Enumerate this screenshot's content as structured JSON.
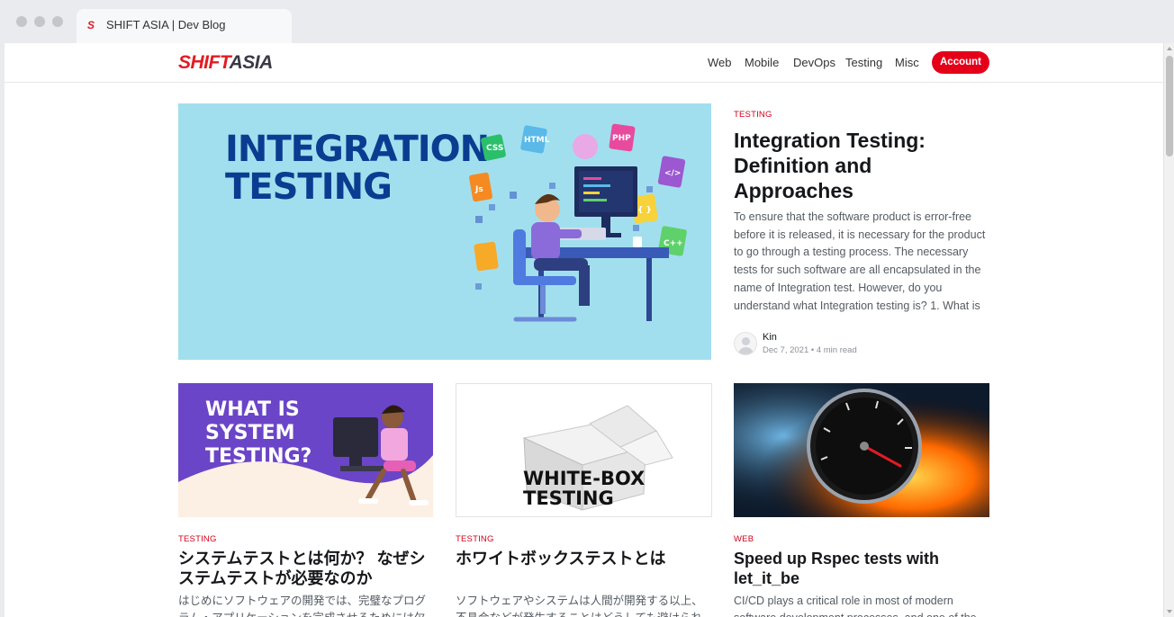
{
  "browser": {
    "tab_title": "SHIFT ASIA | Dev Blog",
    "favicon_glyph": "S"
  },
  "header": {
    "logo_part1": "SHIFT",
    "logo_part2": "ASIA",
    "nav": [
      "Web",
      "Mobile",
      "DevOps",
      "Testing",
      "Misc"
    ],
    "account_label": "Account",
    "accent_color": "#e5001a"
  },
  "featured": {
    "image_text_line1": "INTEGRATION",
    "image_text_line2": "TESTING",
    "image_badges": [
      "CSS",
      "HTML",
      "PHP",
      "</>",
      "Js",
      "{ }",
      "C++"
    ],
    "tag": "TESTING",
    "title": "Integration Testing: Definition and Approaches",
    "excerpt": "To ensure that the software product is error-free before it is released, it is necessary for the product to go through a testing process. The necessary tests for such software are all encapsulated in the name of Integration test. However, do you understand what Integration testing is? 1. What is",
    "author": "Kin",
    "date": "Dec 7, 2021",
    "read_time": "4 min read"
  },
  "cards": [
    {
      "image_text_line1": "WHAT IS",
      "image_text_line2": "SYSTEM",
      "image_text_line3": "TESTING?",
      "tag": "TESTING",
      "title": "システムテストとは何か？ なぜシステムテストが必要なのか",
      "excerpt": "はじめにソフトウェアの開発では、完璧なプログラム・アプリケーションを完成させるためには欠かせない"
    },
    {
      "image_text_line1": "WHITE-BOX",
      "image_text_line2": "TESTING",
      "tag": "TESTING",
      "title": "ホワイトボックステストとは",
      "excerpt": "ソフトウェアやシステムは人間が開発する以上、不具合などが発生することはどうしても避けられません。そうした不具合を防ぐためにはソフトウェア"
    },
    {
      "tag": "WEB",
      "title": "Speed up Rspec tests with let_it_be",
      "excerpt": "CI/CD plays a critical role in most of modern software development processes, and one of the important"
    }
  ]
}
